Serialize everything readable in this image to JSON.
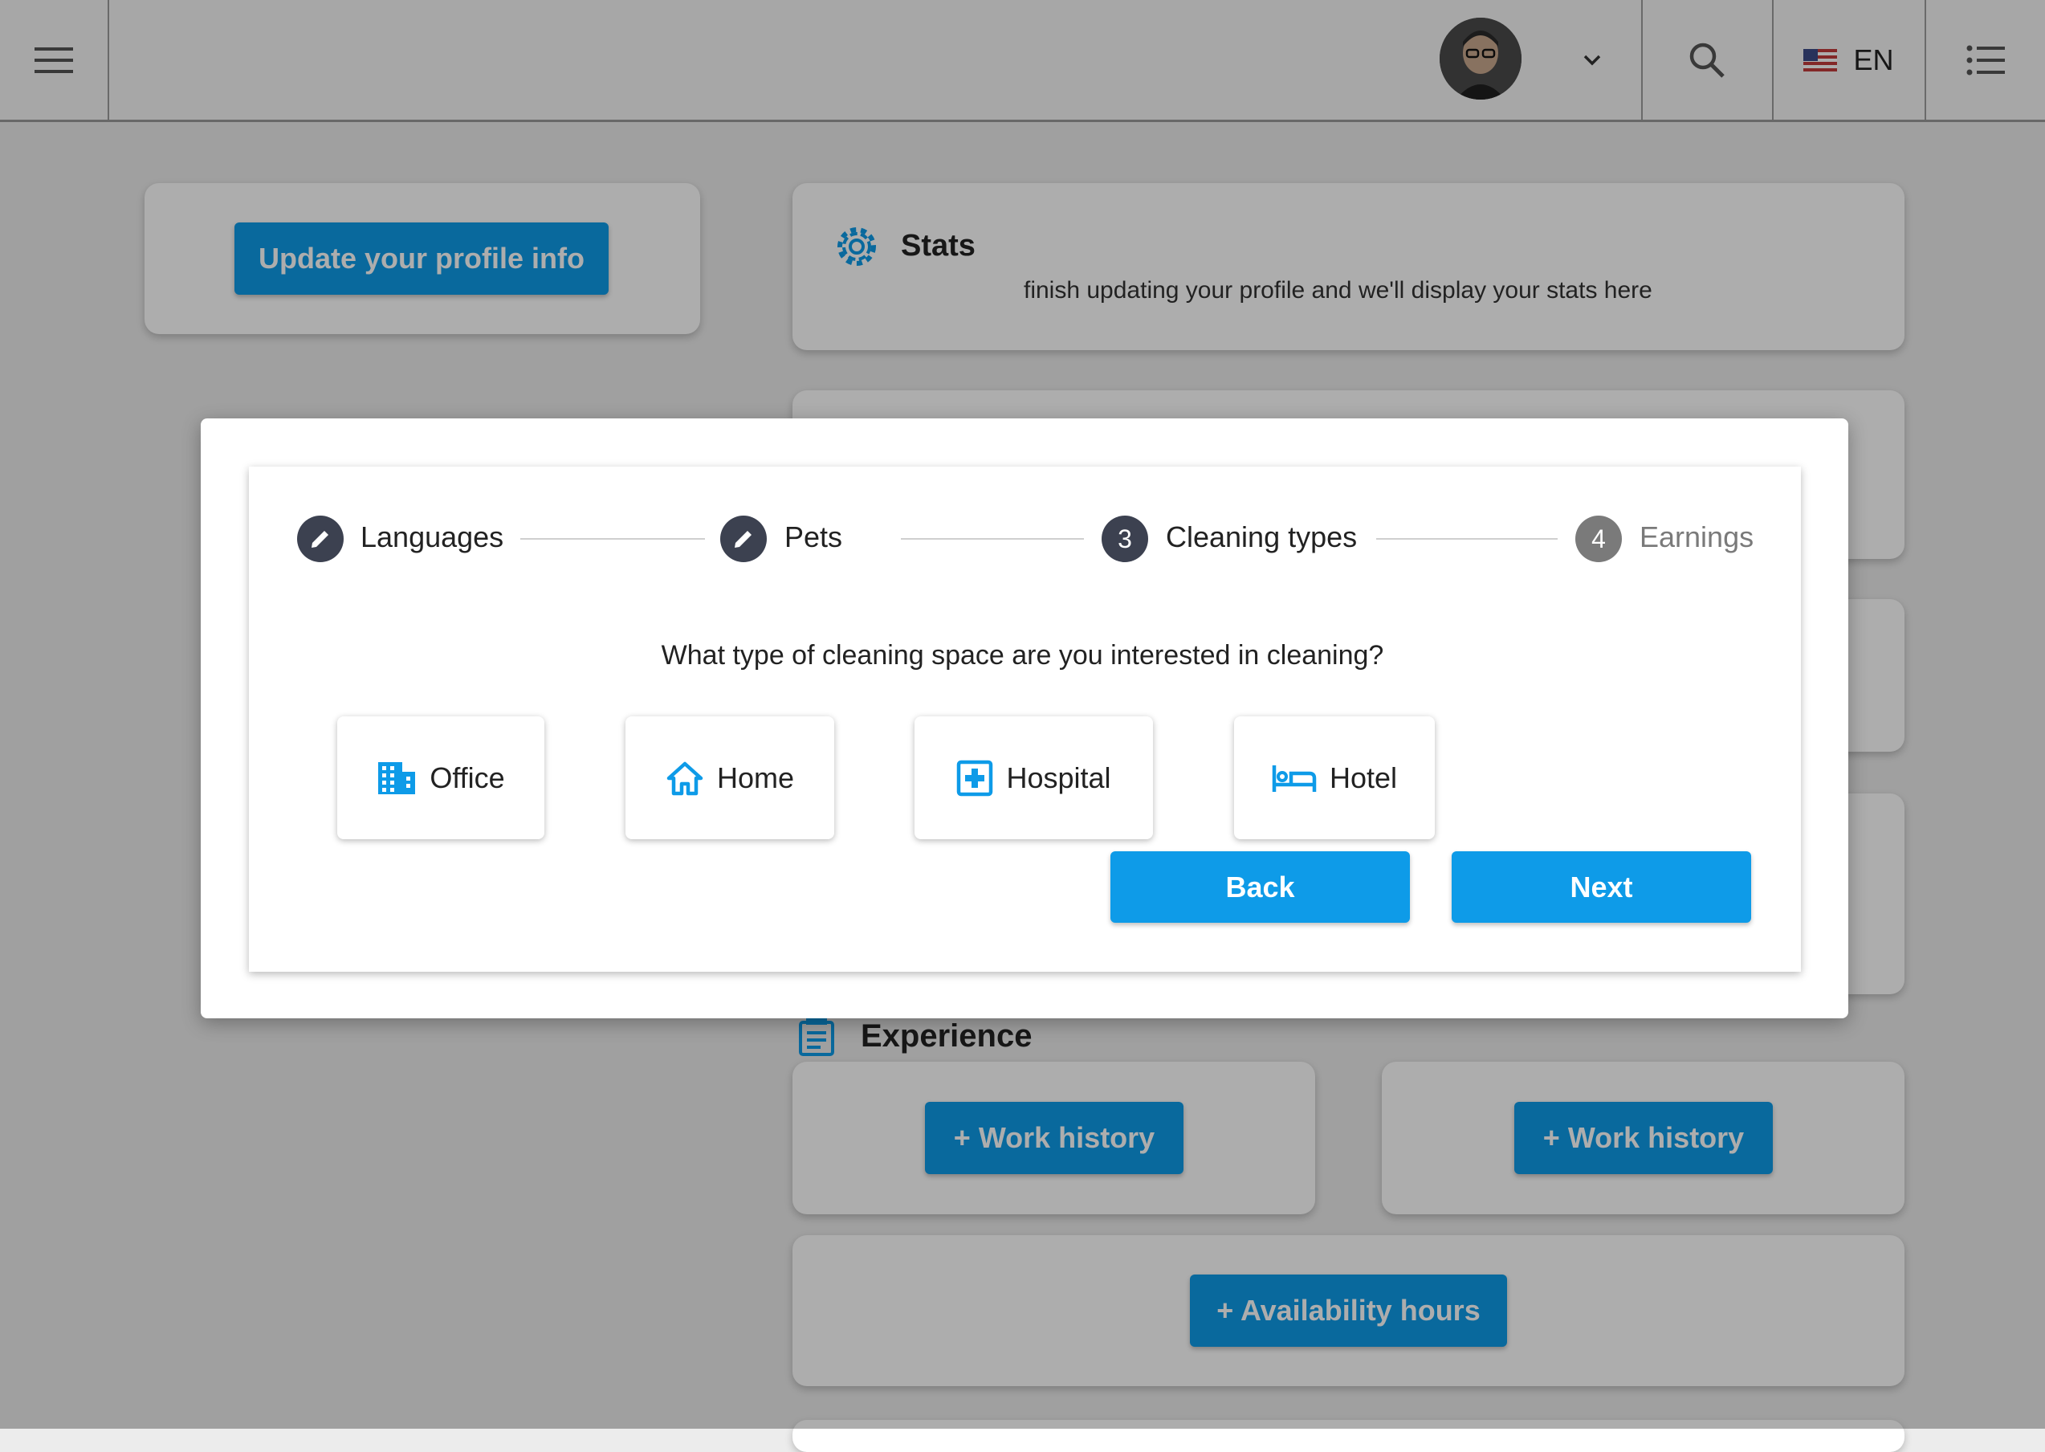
{
  "header": {
    "language_code": "EN"
  },
  "profile_card": {
    "update_button": "Update your profile info"
  },
  "stats": {
    "title": "Stats",
    "subtitle": "finish updating your profile and we'll display your stats here"
  },
  "experience": {
    "title": "Experience",
    "work_history_left": "+ Work history",
    "work_history_right": "+ Work history",
    "availability": "+ Availability hours"
  },
  "wizard": {
    "steps": [
      {
        "label": "Languages",
        "state": "edit"
      },
      {
        "label": "Pets",
        "state": "edit"
      },
      {
        "label": "Cleaning types",
        "number": "3",
        "state": "active"
      },
      {
        "label": "Earnings",
        "number": "4",
        "state": "inactive"
      }
    ],
    "question": "What type of cleaning space are you interested in cleaning?",
    "options": [
      {
        "label": "Office",
        "icon": "office-building-icon"
      },
      {
        "label": "Home",
        "icon": "home-icon"
      },
      {
        "label": "Hospital",
        "icon": "hospital-icon"
      },
      {
        "label": "Hotel",
        "icon": "hotel-bed-icon"
      }
    ],
    "back_label": "Back",
    "next_label": "Next"
  },
  "colors": {
    "accent": "#0e9be8",
    "step_active": "#3c4150",
    "step_inactive": "#7a7a7a"
  }
}
